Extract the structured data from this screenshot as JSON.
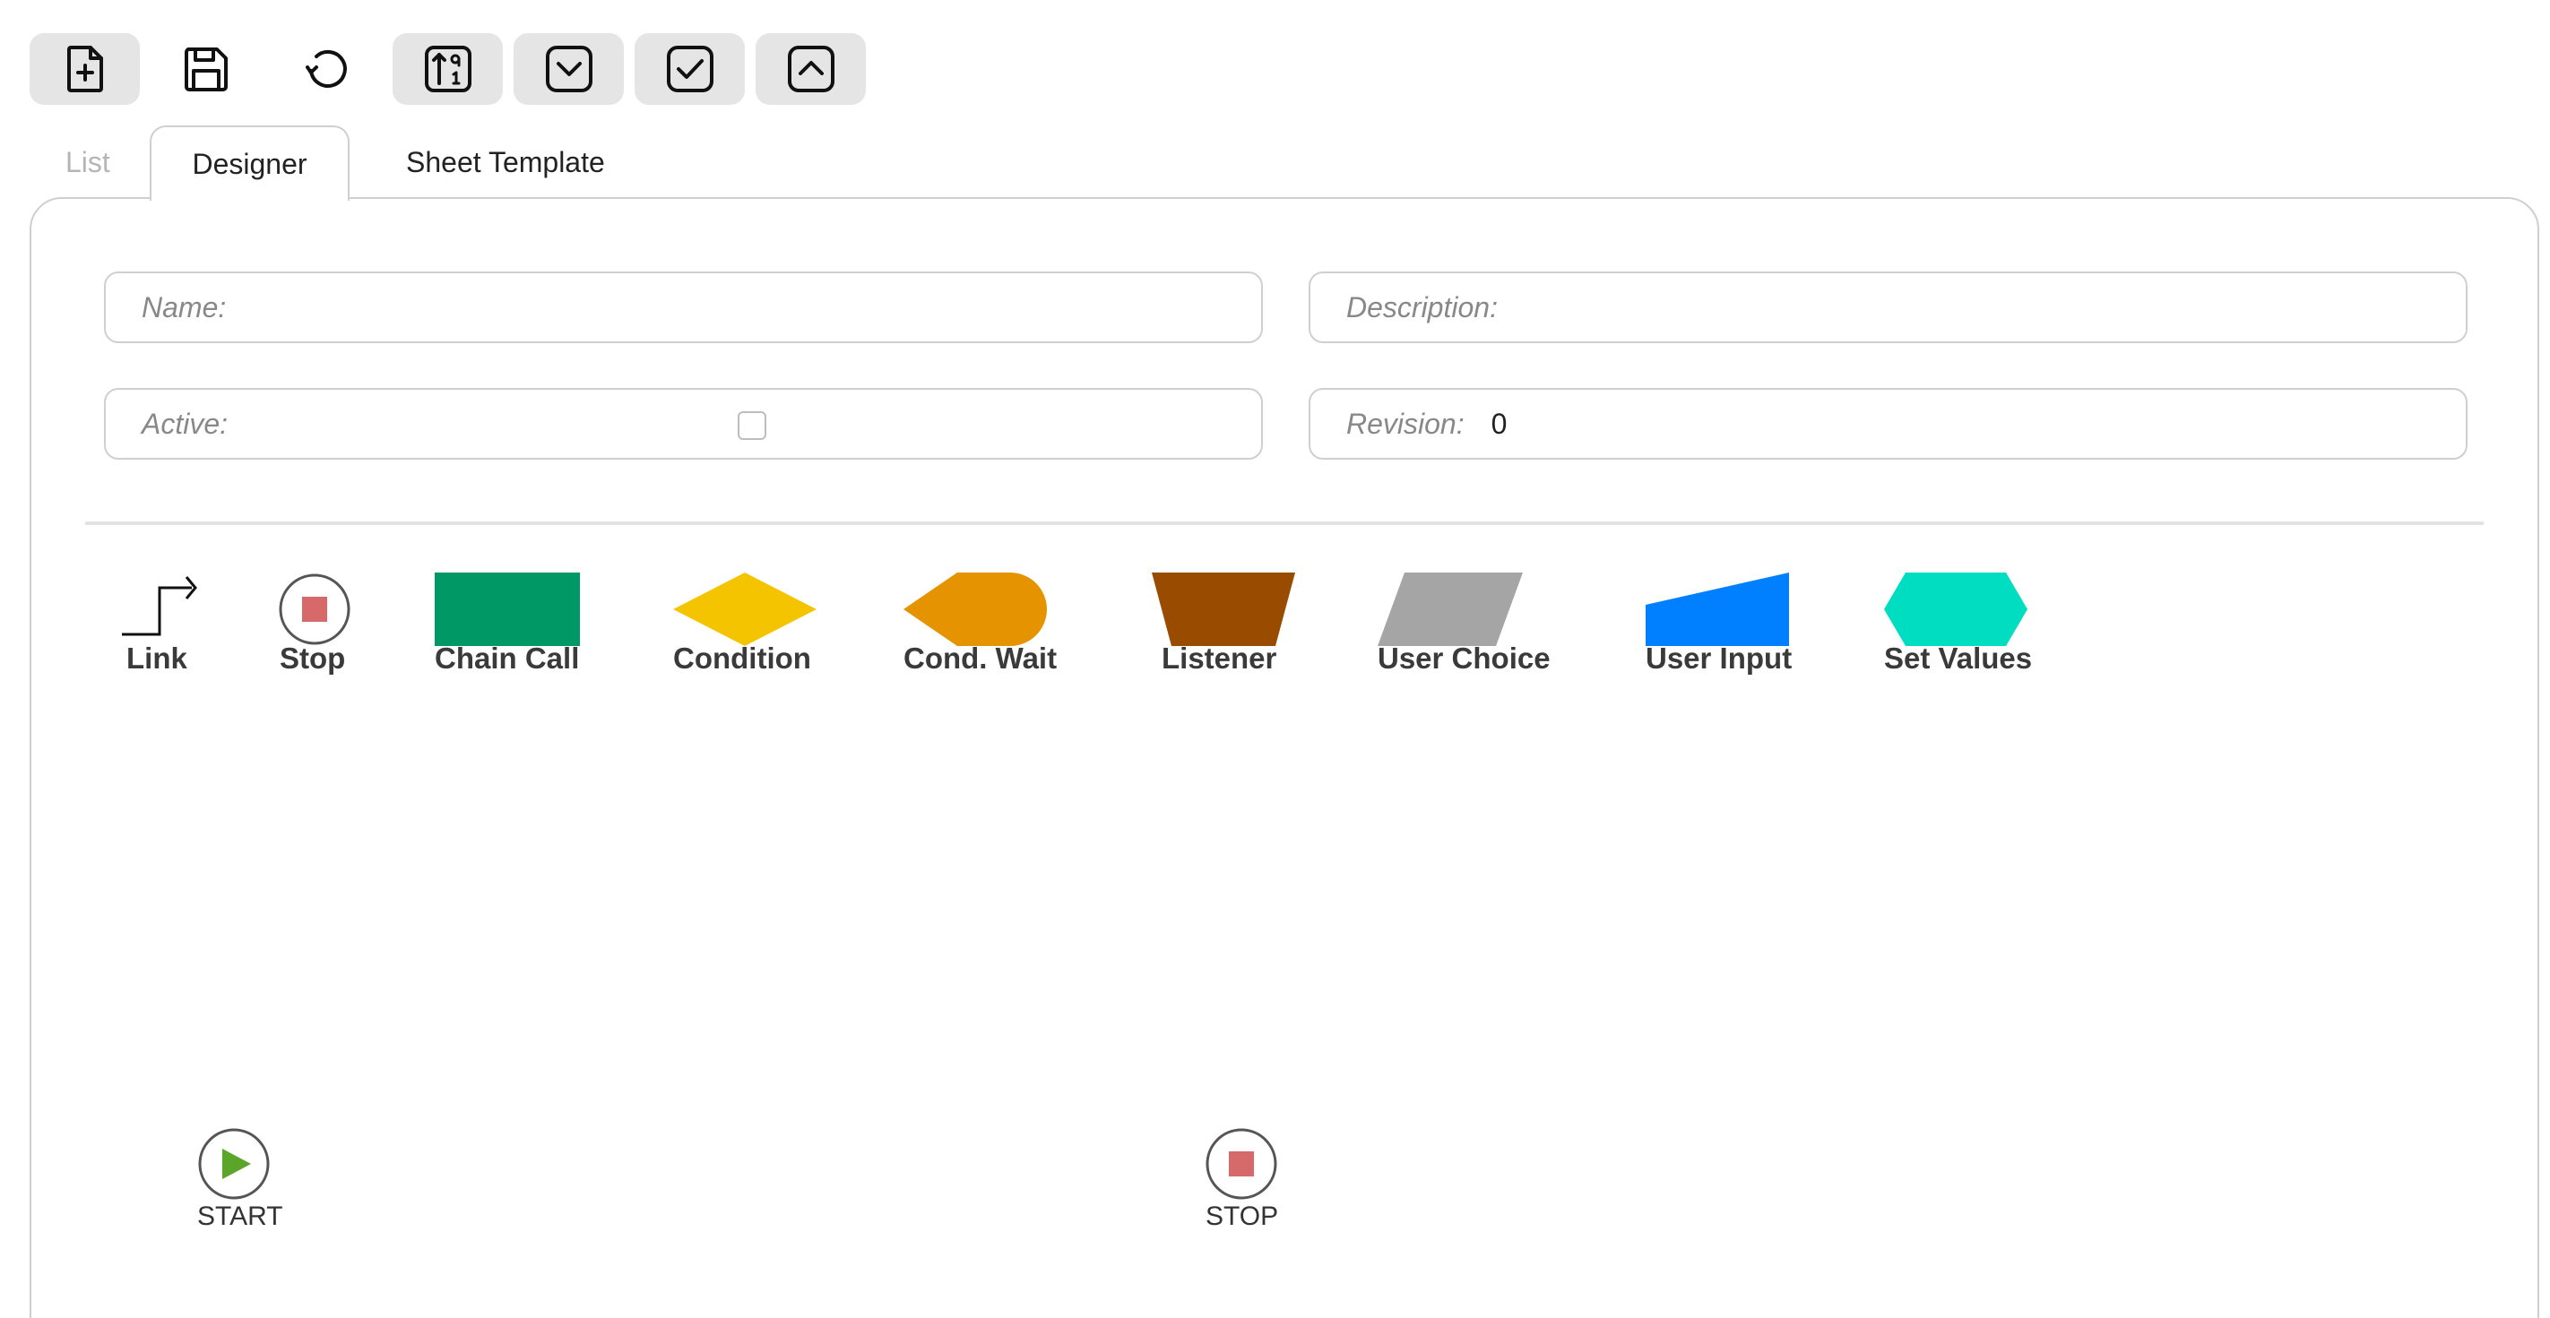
{
  "toolbar": {
    "buttons": [
      {
        "name": "new-document-button",
        "icon": "file-plus-icon"
      },
      {
        "name": "save-button",
        "icon": "floppy-disk-icon"
      },
      {
        "name": "reload-button",
        "icon": "rotate-ccw-icon"
      },
      {
        "name": "sort-button",
        "icon": "sort-numeric-icon"
      },
      {
        "name": "dropdown-button",
        "icon": "chevron-down-square-icon"
      },
      {
        "name": "check-button",
        "icon": "check-square-icon"
      },
      {
        "name": "collapse-button",
        "icon": "chevron-up-square-icon"
      }
    ]
  },
  "tabs": {
    "list": "List",
    "designer": "Designer",
    "sheet_template": "Sheet Template"
  },
  "form": {
    "name_label": "Name:",
    "description_label": "Description:",
    "active_label": "Active:",
    "active_checked": false,
    "revision_label": "Revision:",
    "revision_value": "0"
  },
  "palette": {
    "link": "Link",
    "stop": "Stop",
    "chain_call": "Chain Call",
    "condition": "Condition",
    "cond_wait": "Cond. Wait",
    "listener": "Listener",
    "user_choice": "User Choice",
    "user_input": "User Input",
    "set_values": "Set Values"
  },
  "colors": {
    "chain_call": "#009966",
    "condition": "#f5c400",
    "cond_wait": "#e59400",
    "listener": "#994c00",
    "user_choice": "#a5a5a5",
    "user_input": "#0080ff",
    "set_values": "#00ddc0",
    "stop_square": "#d66a6a",
    "start_triangle": "#5aa52a"
  },
  "canvas": {
    "start_label": "START",
    "stop_label": "STOP"
  }
}
